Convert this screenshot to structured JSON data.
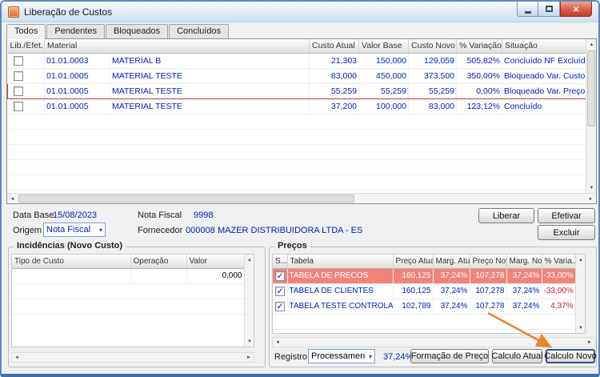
{
  "window": {
    "title": "Liberação de Custos"
  },
  "icons": {
    "close": "×",
    "check": "✓",
    "combo_arrow": "▾",
    "up": "▲",
    "down": "▼",
    "left": "◄",
    "right": "►"
  },
  "tabs": [
    "Todos",
    "Pendentes",
    "Bloqueados",
    "Concluídos"
  ],
  "grid": {
    "headers": {
      "lib": "Lib./Efet.",
      "material": "Material",
      "custo_atual": "Custo Atual",
      "valor_base": "Valor Base",
      "custo_novo": "Custo Novo",
      "variacao": "% Variação",
      "situacao": "Situação"
    },
    "rows": [
      {
        "code": "01.01.0003",
        "name": "MATERIAL B",
        "custo_atual": "21,303",
        "valor_base": "150,000",
        "custo_novo": "129,059",
        "variacao": "505,82%",
        "situacao": "Concluído NF Excluída"
      },
      {
        "code": "01.01.0005",
        "name": "MATERIAL TESTE",
        "custo_atual": "83,000",
        "valor_base": "450,000",
        "custo_novo": "373,500",
        "variacao": "350,00%",
        "situacao": "Bloqueado Var. Custo"
      },
      {
        "code": "01.01.0005",
        "name": "MATERIAL TESTE",
        "custo_atual": "55,259",
        "valor_base": "55,259",
        "custo_novo": "55,259",
        "variacao": "0,00%",
        "situacao": "Bloqueado Var. Preço"
      },
      {
        "code": "01.01.0005",
        "name": "MATERIAL TESTE",
        "custo_atual": "37,200",
        "valor_base": "100,000",
        "custo_novo": "83,000",
        "variacao": "123,12%",
        "situacao": "Concluído"
      }
    ]
  },
  "info": {
    "data_base_label": "Data Base",
    "data_base_value": "15/08/2023",
    "nota_fiscal_label": "Nota Fiscal",
    "nota_fiscal_value": "9998",
    "origem_label": "Origem",
    "origem_value": "Nota Fiscal",
    "fornecedor_label": "Fornecedor",
    "fornecedor_code": "000008",
    "fornecedor_name": "MAZER DISTRIBUIDORA LTDA - ES"
  },
  "actions": {
    "liberar": "Liberar",
    "efetivar": "Efetivar",
    "excluir": "Excluir"
  },
  "incidencias": {
    "title": "Incidências (Novo Custo)",
    "headers": {
      "tipo": "Tipo de Custo",
      "operacao": "Operação",
      "valor": "Valor"
    },
    "valor_value": "0,000"
  },
  "precos": {
    "title": "Preços",
    "headers": {
      "sel": "S...",
      "tabela": "Tabela",
      "preco_atual": "Preço Atual",
      "marg_atual": "Marg. Atual",
      "preco_novo": "Preço Novo",
      "marg_novo": "Marg. Novo",
      "variacao": "% Varia..."
    },
    "rows": [
      {
        "tabela": "TABELA DE PRECOS",
        "preco_atual": "160,125",
        "marg_atual": "37,24%",
        "preco_novo": "107,278",
        "marg_novo": "37,24%",
        "variacao": "-33,00%"
      },
      {
        "tabela": "TABELA DE CLIENTES",
        "preco_atual": "160,125",
        "marg_atual": "37,24%",
        "preco_novo": "107,278",
        "marg_novo": "37,24%",
        "variacao": "-33,00%"
      },
      {
        "tabela": "TABELA TESTE CONTROLADORIA",
        "preco_atual": "102,789",
        "marg_atual": "37,24%",
        "preco_novo": "107,278",
        "marg_novo": "37,24%",
        "variacao": "4,37%"
      }
    ]
  },
  "footer": {
    "registro_label": "Registro",
    "registro_value": "Processamen",
    "percent_value": "37,24%",
    "formacao_btn": "Formação de Preço",
    "calc_atual_btn": "Calculo Atual",
    "calc_novo_btn": "Calculo Novo"
  },
  "colors": {
    "accent_blue": "#0020c0",
    "selected_row": "#f2837a",
    "negative_red": "#cc1f1f",
    "arrow_orange": "#ea822c",
    "current_row_border": "#b5413b"
  }
}
